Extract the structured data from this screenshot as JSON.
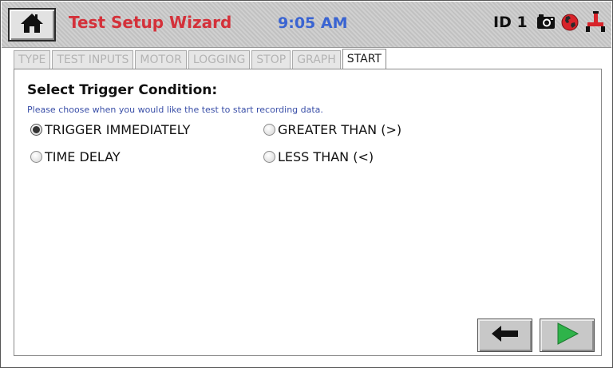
{
  "header": {
    "title": "Test Setup Wizard",
    "time": "9:05 AM",
    "id_label": "ID 1",
    "icons": [
      "home-icon",
      "camera-icon",
      "globe-icon",
      "usb-plug-icon"
    ],
    "colors": {
      "title": "#d4313a",
      "time": "#3a64d2"
    }
  },
  "tabs": [
    {
      "label": "TYPE",
      "active": false
    },
    {
      "label": "TEST INPUTS",
      "active": false
    },
    {
      "label": "MOTOR",
      "active": false
    },
    {
      "label": "LOGGING",
      "active": false
    },
    {
      "label": "STOP",
      "active": false
    },
    {
      "label": "GRAPH",
      "active": false
    },
    {
      "label": "START",
      "active": true
    }
  ],
  "panel": {
    "heading": "Select Trigger Condition:",
    "instruction": "Please choose when you would like the test to start recording data.",
    "options": [
      {
        "label": "TRIGGER IMMEDIATELY",
        "selected": true
      },
      {
        "label": "GREATER THAN (>)",
        "selected": false
      },
      {
        "label": "TIME DELAY",
        "selected": false
      },
      {
        "label": "LESS THAN (<)",
        "selected": false
      }
    ]
  },
  "navigation": {
    "back_icon": "arrow-left-icon",
    "next_icon": "play-right-icon"
  }
}
